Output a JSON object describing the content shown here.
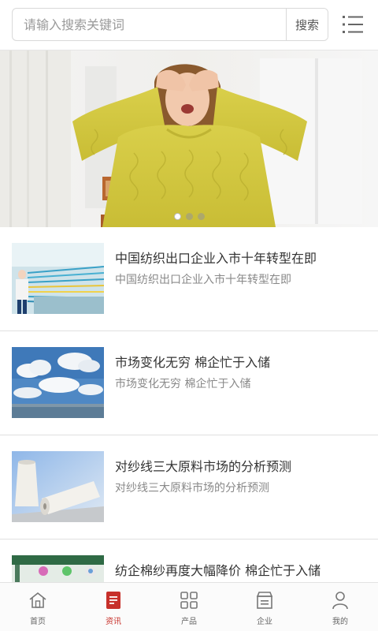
{
  "search": {
    "placeholder": "请输入搜索关键词",
    "button_label": "搜索"
  },
  "header": {
    "menu_icon": "list-menu-icon"
  },
  "banner": {
    "slide_count": 3,
    "active_slide": 1
  },
  "news": [
    {
      "title": "中国纺织出口企业入市十年转型在即",
      "desc": "中国纺织出口企业入市十年转型在即",
      "thumb": "textile-factory-image"
    },
    {
      "title": "市场变化无穷 棉企忙于入储",
      "desc": "市场变化无穷 棉企忙于入储",
      "thumb": "sky-clouds-image"
    },
    {
      "title": "对纱线三大原料市场的分析预测",
      "desc": "对纱线三大原料市场的分析预测",
      "thumb": "yarn-spools-image"
    },
    {
      "title": "纺企棉纱再度大幅降价 棉企忙于入储",
      "desc": "",
      "thumb": "yarn-machine-image"
    }
  ],
  "nav": [
    {
      "label": "首页",
      "icon": "home-icon",
      "active": false
    },
    {
      "label": "资讯",
      "icon": "news-icon",
      "active": true
    },
    {
      "label": "产品",
      "icon": "products-grid-icon",
      "active": false
    },
    {
      "label": "企业",
      "icon": "company-icon",
      "active": false
    },
    {
      "label": "我的",
      "icon": "user-icon",
      "active": false
    }
  ],
  "colors": {
    "accent": "#c7302a",
    "nav_inactive": "#666666"
  }
}
